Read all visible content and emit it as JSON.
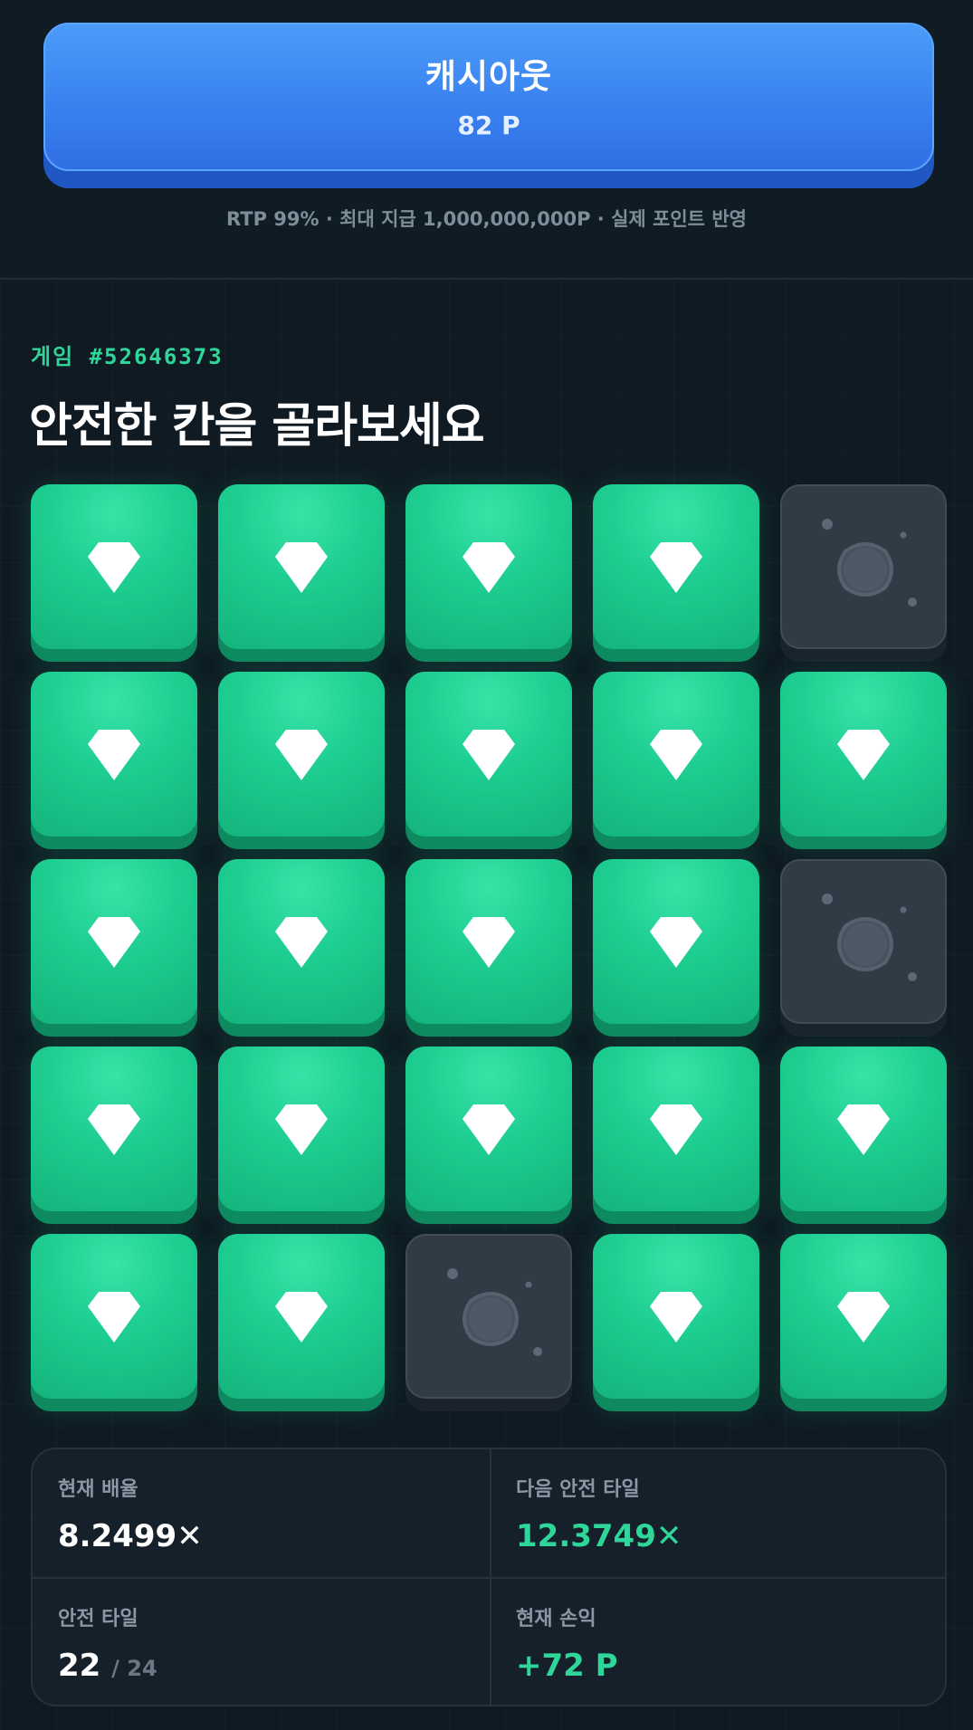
{
  "cashout": {
    "label": "캐시아웃",
    "amount": "82 P"
  },
  "rtp_note": "RTP 99% · 최대 지급 1,000,000,000P · 실제 포인트 반영",
  "game": {
    "id_label": "게임 #52646373",
    "title": "안전한 칸을 골라보세요"
  },
  "grid": {
    "rows": 5,
    "cols": 5,
    "tiles": [
      "gem",
      "gem",
      "gem",
      "gem",
      "mine",
      "gem",
      "gem",
      "gem",
      "gem",
      "gem",
      "gem",
      "gem",
      "gem",
      "gem",
      "mine",
      "gem",
      "gem",
      "gem",
      "gem",
      "gem",
      "gem",
      "gem",
      "mine",
      "gem",
      "gem"
    ]
  },
  "stats": {
    "current_multiplier": {
      "label": "현재 배율",
      "value": "8.2499✕"
    },
    "next_safe_tile": {
      "label": "다음 안전 타일",
      "value": "12.3749✕"
    },
    "safe_tiles": {
      "label": "안전 타일",
      "value": "22",
      "total": "/ 24"
    },
    "current_profit": {
      "label": "현재 손익",
      "value": "+72 P"
    }
  },
  "colors": {
    "accent_green": "#2fd69a",
    "cashout_blue": "#3a82ef",
    "background": "#0f1a22",
    "mine_tile": "#313b45"
  },
  "icons": {
    "gem": "diamond-icon",
    "mine": "bomb-icon"
  }
}
